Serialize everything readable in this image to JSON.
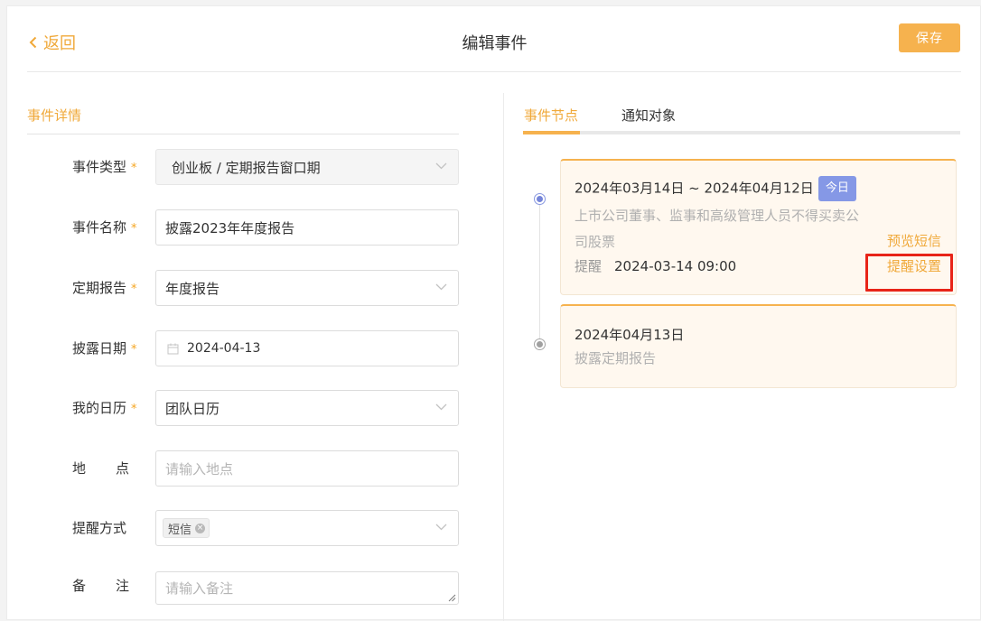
{
  "header": {
    "back_label": "返回",
    "title": "编辑事件",
    "save_label": "保存"
  },
  "form": {
    "section_title": "事件详情",
    "event_type": {
      "label": "事件类型",
      "value": "创业板 / 定期报告窗口期"
    },
    "event_name": {
      "label": "事件名称",
      "value": "披露2023年年度报告"
    },
    "periodic_report": {
      "label": "定期报告",
      "value": "年度报告"
    },
    "disclosure_date": {
      "label": "披露日期",
      "value": "2024-04-13"
    },
    "my_calendar": {
      "label": "我的日历",
      "value": "团队日历"
    },
    "location": {
      "label_a": "地",
      "label_b": "点",
      "placeholder": "请输入地点"
    },
    "remind_method": {
      "label": "提醒方式",
      "tag": "短信"
    },
    "remark": {
      "label_a": "备",
      "label_b": "注",
      "placeholder": "请输入备注"
    },
    "required_mark": "*"
  },
  "tabs": [
    {
      "label": "事件节点",
      "active": true
    },
    {
      "label": "通知对象",
      "active": false
    }
  ],
  "timeline": [
    {
      "date": "2024年03月14日 ~ 2024年04月12日",
      "badge": "今日",
      "desc_line1": "上市公司董事、监事和高级管理人员不得买卖公",
      "desc_line2": "司股票",
      "remind_label": "提醒",
      "remind_time": "2024-03-14 09:00",
      "preview_sms": "预览短信",
      "remind_settings": "提醒设置"
    },
    {
      "date": "2024年04月13日",
      "desc": "披露定期报告"
    }
  ],
  "colors": {
    "accent": "#f0a93a",
    "button": "#f6b24e",
    "badge": "#8598e6",
    "highlight": "#e82418"
  }
}
